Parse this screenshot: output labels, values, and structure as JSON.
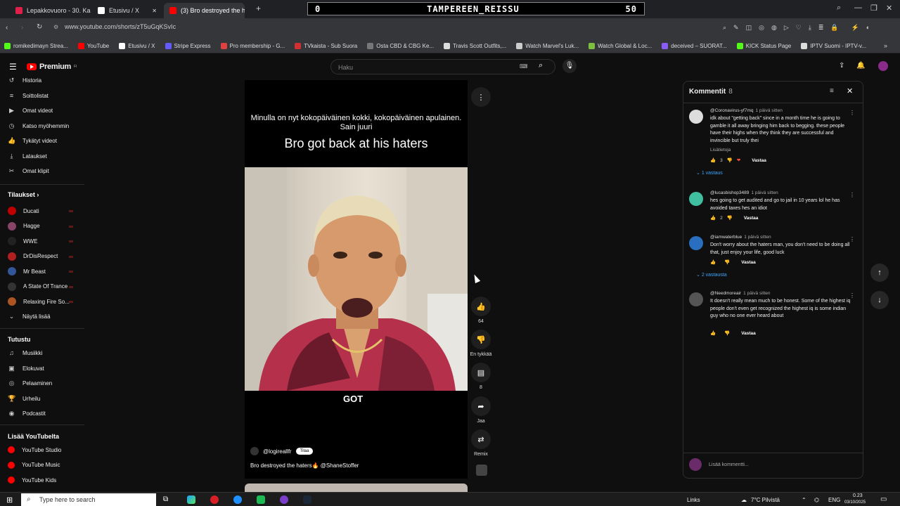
{
  "browser": {
    "tabs": [
      {
        "label": "Lepakkovuoro - 30. Kausi",
        "color": "#e0204a"
      },
      {
        "label": "Etusivu / X",
        "color": "#ffffff"
      },
      {
        "label": "(3) Bro destroyed the hat",
        "color": "#ff0000"
      }
    ],
    "stream_overlay": {
      "left": "0",
      "title": "TAMPEREEN_REISSU",
      "right": "50"
    },
    "url": "www.youtube.com/shorts/zT5uGqKSvIc",
    "bookmarks": [
      {
        "label": "romikedimayn Strea...",
        "color": "#53fc18"
      },
      {
        "label": "YouTube",
        "color": "#ff0000"
      },
      {
        "label": "Etusivu / X",
        "color": "#ffffff"
      },
      {
        "label": "Stripe Express",
        "color": "#635bff"
      },
      {
        "label": "Pro membership - G...",
        "color": "#e04040"
      },
      {
        "label": "TVkaista - Sub Suora",
        "color": "#d03030"
      },
      {
        "label": "Osta CBD & CBG Ke...",
        "color": "#777777"
      },
      {
        "label": "Travis Scott Outfits,...",
        "color": "#dddddd"
      },
      {
        "label": "Watch Marvel's Luk...",
        "color": "#cccccc"
      },
      {
        "label": "Watch Global & Loc...",
        "color": "#7fbf3f"
      },
      {
        "label": "deceived – SUORAT...",
        "color": "#8a5cf6"
      },
      {
        "label": "KICK Status Page",
        "color": "#53fc18"
      },
      {
        "label": "IPTV Suomi - IPTV-v...",
        "color": "#dddddd"
      }
    ]
  },
  "youtube": {
    "logo_text": "Premium",
    "logo_sup": "FI",
    "search_placeholder": "Haku"
  },
  "sidebar": {
    "items": [
      {
        "label": "Historia",
        "icon": "history-icon",
        "glyph": "↺"
      },
      {
        "label": "Soittolistat",
        "icon": "playlists-icon",
        "glyph": "≡"
      },
      {
        "label": "Omat videot",
        "icon": "your-videos-icon",
        "glyph": "▶"
      },
      {
        "label": "Katso myöhemmin",
        "icon": "watch-later-icon",
        "glyph": "◷"
      },
      {
        "label": "Tykätyt videot",
        "icon": "liked-videos-icon",
        "glyph": "👍"
      },
      {
        "label": "Lataukset",
        "icon": "downloads-icon",
        "glyph": "⤓"
      },
      {
        "label": "Omat klipit",
        "icon": "clips-icon",
        "glyph": "✂"
      }
    ],
    "subs_heading": "Tilaukset",
    "subs": [
      {
        "label": "Ducati",
        "color": "#c00000"
      },
      {
        "label": "Hagge",
        "color": "#884466"
      },
      {
        "label": "WWE",
        "color": "#222222"
      },
      {
        "label": "DrDisRespect",
        "color": "#b02020"
      },
      {
        "label": "Mr Beast",
        "color": "#335599"
      },
      {
        "label": "A State Of Trance",
        "color": "#333333"
      },
      {
        "label": "Relaxing Fire So...",
        "color": "#aa5522"
      }
    ],
    "show_more": "Näytä lisää",
    "explore_heading": "Tutustu",
    "explore": [
      {
        "label": "Musiikki",
        "icon": "music-icon",
        "glyph": "♫"
      },
      {
        "label": "Elokuvat",
        "icon": "movies-icon",
        "glyph": "▣"
      },
      {
        "label": "Pelaaminen",
        "icon": "gaming-icon",
        "glyph": "◎"
      },
      {
        "label": "Urheilu",
        "icon": "sports-icon",
        "glyph": "🏆"
      },
      {
        "label": "Podcastit",
        "icon": "podcasts-icon",
        "glyph": "◉"
      }
    ],
    "more_heading": "Lisää YouTubelta",
    "more": [
      {
        "label": "YouTube Studio",
        "color": "#ff0000"
      },
      {
        "label": "YouTube Music",
        "color": "#ff0000"
      },
      {
        "label": "YouTube Kids",
        "color": "#ff0000"
      }
    ]
  },
  "video": {
    "caption_small": "Minulla on nyt kokopäiväinen kokki, kokopäiväinen apulainen. Sain juuri",
    "caption_big": "Bro got back at his haters",
    "overlay_word": "GOT",
    "channel": "@logireallfr",
    "subscribe": "Tilaa",
    "title": "Bro destroyed the haters🔥 @ShaneStoffer"
  },
  "actions": {
    "like_count": "64",
    "dislike_label": "En tykkää",
    "comment_count": "8",
    "share_label": "Jaa",
    "remix_label": "Remix"
  },
  "comments": {
    "title": "Kommentit",
    "count": "8",
    "items": [
      {
        "author": "@Coronavirus-yf7mq",
        "time": "1 päivä sitten",
        "text": "idk about \"getting back\" since in a month time he is going to gamble it all away bringing him back to begging. these people have their highs when they think they are successful and invincible but truly thei",
        "read_more": "Lisätietoja",
        "likes": "3",
        "reply": "Vastaa",
        "replies": "1 vastaus",
        "avatar": "#dddddd"
      },
      {
        "author": "@lucasbishop3489",
        "time": "1 päivä sitten",
        "text": "hes going to get audited and go to jail in 10 years lol he has avoided taxes hes an idiot",
        "likes": "2",
        "reply": "Vastaa",
        "avatar": "#3fbf9f"
      },
      {
        "author": "@iamwaterblue",
        "time": "1 päivä sitten",
        "text": "Don't worry about the haters man, you don't need to be doing all that, just enjoy your life, good luck",
        "likes": "",
        "reply": "Vastaa",
        "replies": "2 vastausta",
        "avatar": "#2a6fbf"
      },
      {
        "author": "@Needmoreair",
        "time": "1 päivä sitten",
        "text": "It doesn't really mean much to be honest. Some of the highest iq people don't even get recognized the highest iq is some indian guy who no one ever heard about",
        "likes": "",
        "reply": "Vastaa",
        "avatar": "#555555"
      }
    ],
    "add_placeholder": "Lisää kommentti..."
  },
  "taskbar": {
    "search_placeholder": "Type here to search",
    "links": "Links",
    "weather": "7°C Pilvistä",
    "lang": "ENG",
    "time": "0.23",
    "date": "03/10/2025"
  }
}
